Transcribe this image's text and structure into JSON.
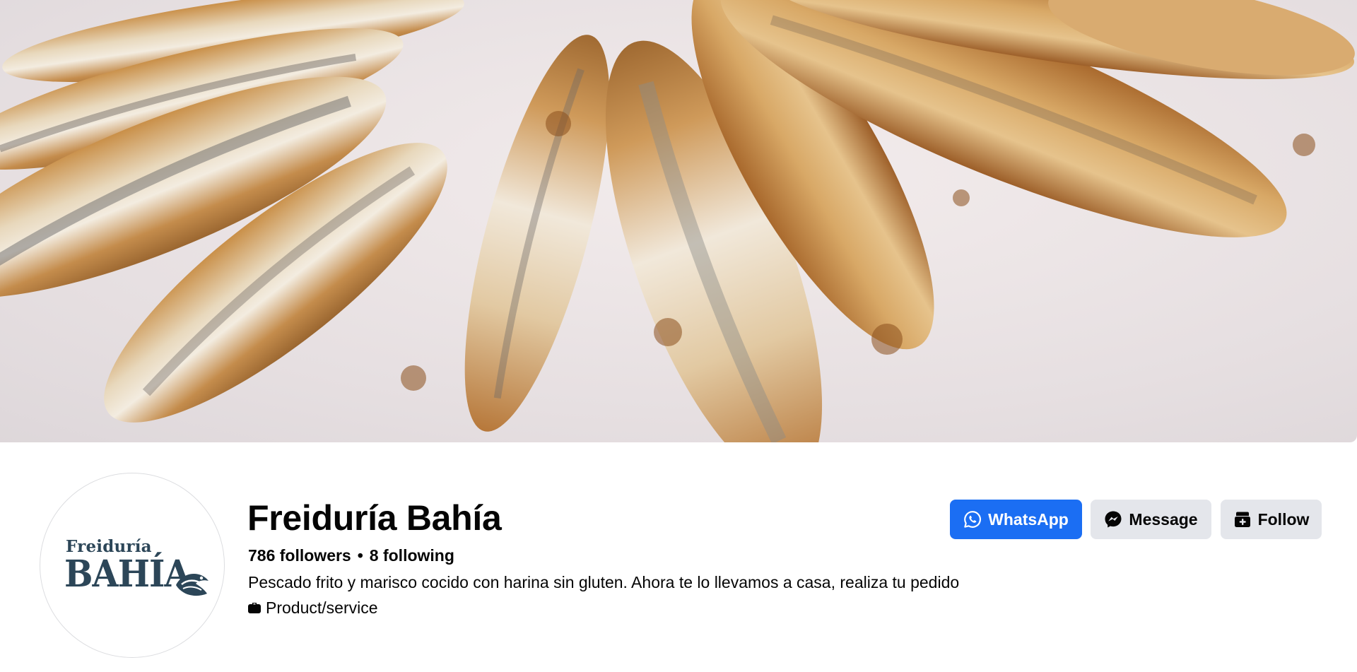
{
  "cover": {
    "alt": "Cover photo of fried anchovies"
  },
  "profile": {
    "logo_line1": "Freiduría",
    "logo_line2": "BAHÍA",
    "name": "Freiduría Bahía",
    "followers": "786 followers",
    "following": "8 following",
    "separator": "•",
    "bio": "Pescado frito y marisco cocido con harina sin gluten. Ahora te lo llevamos a casa, realiza tu pedido",
    "category": "Product/service"
  },
  "actions": {
    "whatsapp_label": "WhatsApp",
    "message_label": "Message",
    "follow_label": "Follow"
  },
  "colors": {
    "whatsapp_button": "#1b6ef3",
    "secondary_button": "#e4e6eb",
    "logo_navy": "#2c4658",
    "text_primary": "#050505"
  },
  "icons": {
    "whatsapp": "whatsapp-icon",
    "message": "messenger-icon",
    "follow": "follow-icon",
    "category": "category-icon"
  }
}
